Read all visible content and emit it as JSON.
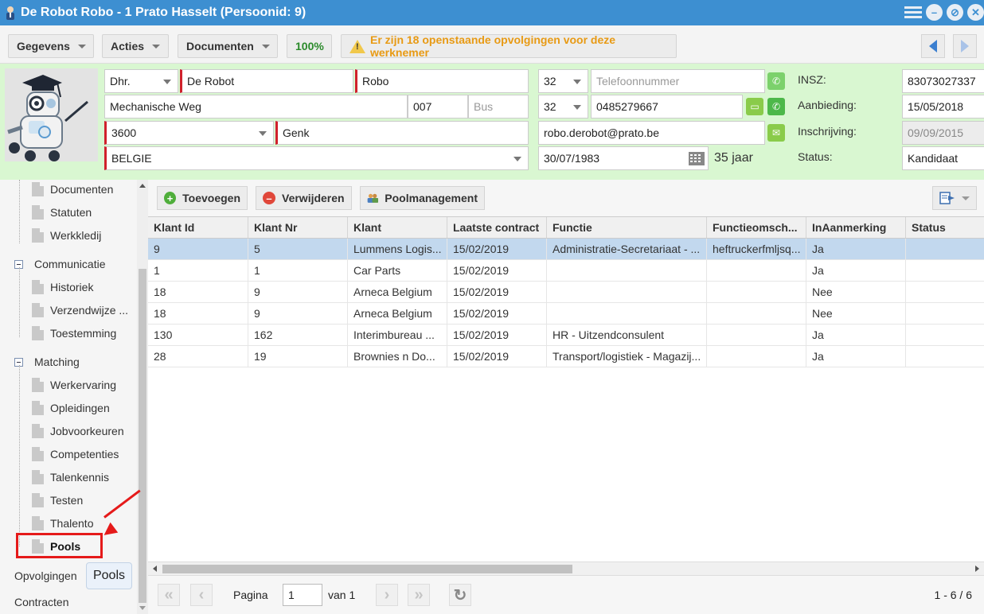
{
  "window": {
    "title": "De Robot Robo - 1 Prato Hasselt (Persoonid: 9)",
    "buttons": [
      "menu-icon",
      "minimize-icon",
      "restore-icon",
      "close-icon"
    ]
  },
  "toolbar": {
    "gegevens": "Gegevens",
    "acties": "Acties",
    "documenten": "Documenten",
    "zoom": "100%",
    "warning": "Er zijn 18 openstaande opvolgingen voor deze werknemer"
  },
  "person": {
    "aanspreking": "Dhr.",
    "achternaam": "De Robot",
    "voornaam": "Robo",
    "straat": "Mechanische Weg",
    "huisnr": "007",
    "bus_placeholder": "Bus",
    "postcode": "3600",
    "gemeente": "Genk",
    "land": "BELGIE",
    "tel_prefix": "32",
    "tel_placeholder": "Telefoonnummer",
    "gsm_prefix": "32",
    "gsm": "0485279667",
    "email": "robo.derobot@prato.be",
    "geboortedatum": "30/07/1983",
    "leeftijd": "35 jaar",
    "insz_label": "INSZ:",
    "insz": "83073027337",
    "aanbieding_label": "Aanbieding:",
    "aanbieding": "15/05/2018",
    "inschrijving_label": "Inschrijving:",
    "inschrijving": "09/09/2015",
    "status_label": "Status:",
    "status": "Kandidaat"
  },
  "sidebar": {
    "items_top": [
      "Documenten",
      "Statuten",
      "Werkkledij"
    ],
    "group_communicatie": "Communicatie",
    "items_communicatie": [
      "Historiek",
      "Verzendwijze ...",
      "Toestemming"
    ],
    "group_matching": "Matching",
    "items_matching": [
      "Werkervaring",
      "Opleidingen",
      "Jobvoorkeuren",
      "Competenties",
      "Talenkennis",
      "Testen",
      "Thalento",
      "Pools"
    ],
    "opvolgingen": "Opvolgingen",
    "contracten": "Contracten",
    "tooltip": "Pools"
  },
  "main": {
    "toevoegen": "Toevoegen",
    "verwijderen": "Verwijderen",
    "poolmanagement": "Poolmanagement",
    "columns": [
      "Klant Id",
      "Klant Nr",
      "Klant",
      "Laatste contract",
      "Functie",
      "Functieomsch...",
      "InAanmerking",
      "Status"
    ],
    "rows": [
      [
        "9",
        "5",
        "Lummens Logis...",
        "15/02/2019",
        "Administratie-Secretariaat - ...",
        "heftruckerfmljsq...",
        "Ja",
        ""
      ],
      [
        "1",
        "1",
        "Car Parts",
        "15/02/2019",
        "",
        "",
        "Ja",
        ""
      ],
      [
        "18",
        "9",
        "Arneca Belgium",
        "15/02/2019",
        "",
        "",
        "Nee",
        ""
      ],
      [
        "18",
        "9",
        "Arneca Belgium",
        "15/02/2019",
        "",
        "",
        "Nee",
        ""
      ],
      [
        "130",
        "162",
        "Interimbureau ...",
        "15/02/2019",
        "HR - Uitzendconsulent",
        "",
        "Ja",
        ""
      ],
      [
        "28",
        "19",
        "Brownies n Do...",
        "15/02/2019",
        "Transport/logistiek - Magazij...",
        "",
        "Ja",
        ""
      ]
    ],
    "pager": {
      "pagina_label": "Pagina",
      "page": "1",
      "van_label": "van 1",
      "range": "1 - 6 / 6"
    }
  },
  "colors": {
    "titlebar": "#3d8fd1",
    "header_bg": "#d9f7d1",
    "selected_row": "#c2d8ee",
    "required_marker": "#d0212c",
    "annotation": "#e51a1a"
  }
}
